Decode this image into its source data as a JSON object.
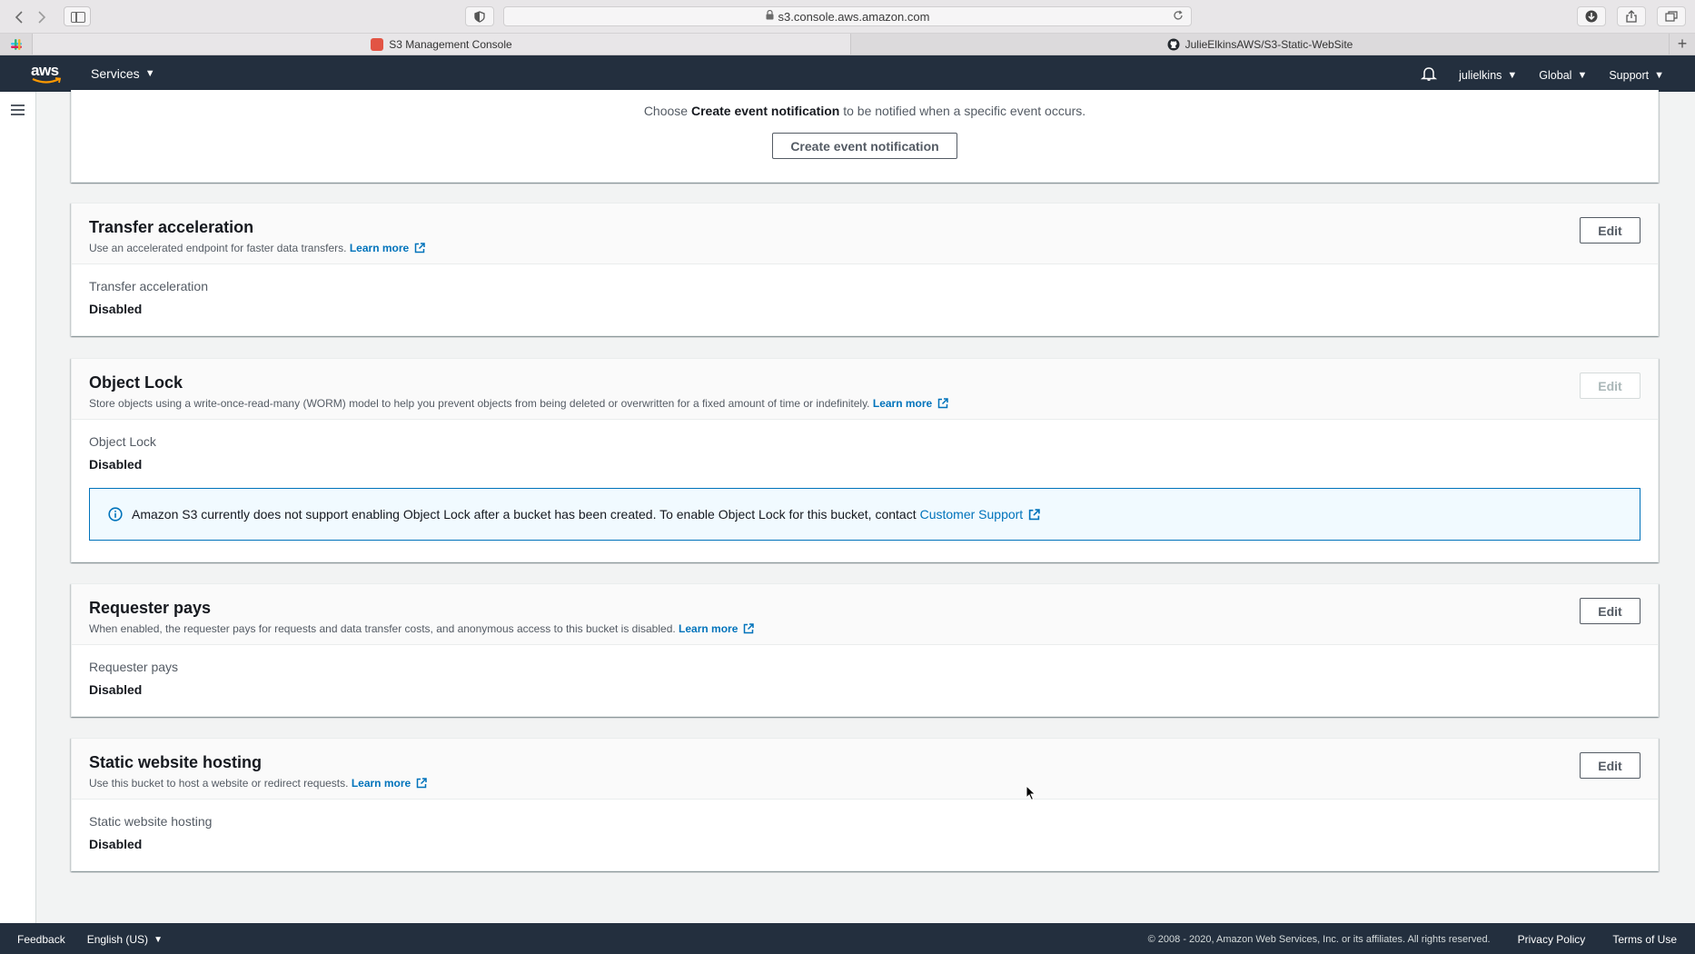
{
  "browser": {
    "url": "s3.console.aws.amazon.com",
    "tabs": [
      {
        "label": "S3 Management Console"
      },
      {
        "label": "JulieElkinsAWS/S3-Static-WebSite"
      }
    ]
  },
  "header": {
    "logo": "aws",
    "services_label": "Services",
    "user_label": "julielkins",
    "region_label": "Global",
    "support_label": "Support"
  },
  "event_notifications": {
    "text_prefix": "Choose ",
    "text_bold": "Create event notification",
    "text_suffix": " to be notified when a specific event occurs.",
    "button_label": "Create event notification"
  },
  "transfer_acceleration": {
    "title": "Transfer acceleration",
    "description": "Use an accelerated endpoint for faster data transfers.",
    "learn_more": "Learn more",
    "edit_label": "Edit",
    "field_label": "Transfer acceleration",
    "field_value": "Disabled"
  },
  "object_lock": {
    "title": "Object Lock",
    "description": "Store objects using a write-once-read-many (WORM) model to help you prevent objects from being deleted or overwritten for a fixed amount of time or indefinitely.",
    "learn_more": "Learn more",
    "edit_label": "Edit",
    "field_label": "Object Lock",
    "field_value": "Disabled",
    "alert_text": "Amazon S3 currently does not support enabling Object Lock after a bucket has been created. To enable Object Lock for this bucket, contact",
    "alert_link": "Customer Support"
  },
  "requester_pays": {
    "title": "Requester pays",
    "description": "When enabled, the requester pays for requests and data transfer costs, and anonymous access to this bucket is disabled.",
    "learn_more": "Learn more",
    "edit_label": "Edit",
    "field_label": "Requester pays",
    "field_value": "Disabled"
  },
  "static_website_hosting": {
    "title": "Static website hosting",
    "description": "Use this bucket to host a website or redirect requests.",
    "learn_more": "Learn more",
    "edit_label": "Edit",
    "field_label": "Static website hosting",
    "field_value": "Disabled"
  },
  "footer": {
    "feedback": "Feedback",
    "language": "English (US)",
    "copyright": "© 2008 - 2020, Amazon Web Services, Inc. or its affiliates. All rights reserved.",
    "privacy": "Privacy Policy",
    "terms": "Terms of Use"
  },
  "colors": {
    "aws_nav": "#232f3e",
    "link": "#0073bb",
    "alert_bg": "#f1faff"
  }
}
